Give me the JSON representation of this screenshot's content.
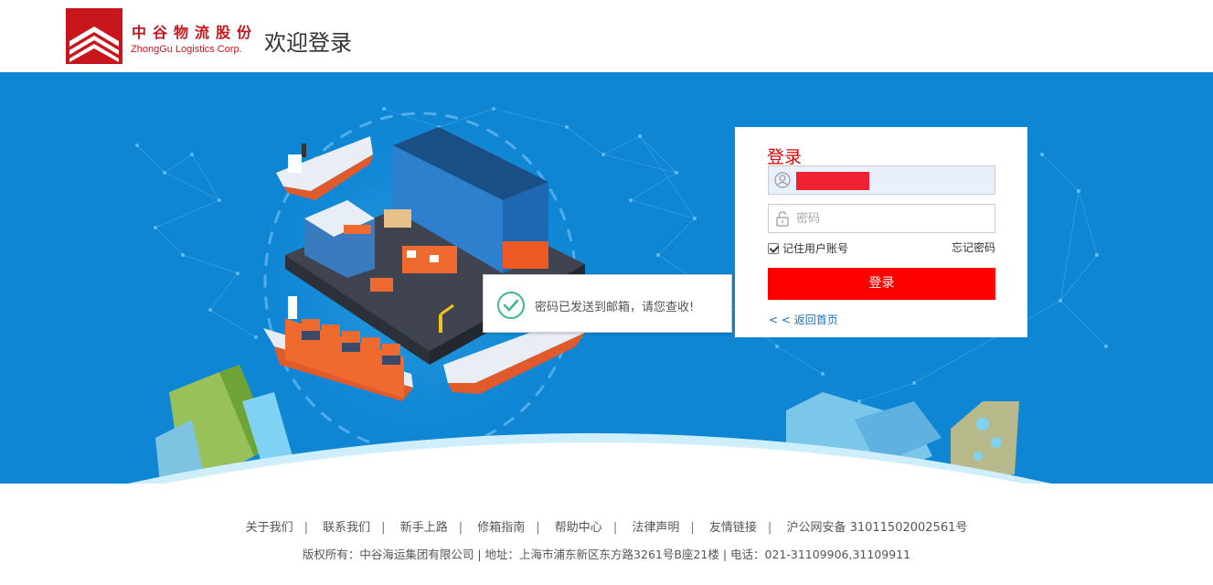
{
  "header": {
    "logo_cn": "中谷物流股份",
    "logo_en": "ZhongGu Logistics Corp.",
    "welcome": "欢迎登录"
  },
  "login": {
    "title": "登录",
    "username_value": "",
    "password_placeholder": "密码",
    "remember_label": "记住用户账号",
    "remember_checked": true,
    "forgot_label": "忘记密码",
    "submit_label": "登录",
    "back_label": "< < 返回首页"
  },
  "toast": {
    "message": "密码已发送到邮箱，请您查收!"
  },
  "footer": {
    "links": [
      "关于我们",
      "联系我们",
      "新手上路",
      "修箱指南",
      "帮助中心",
      "法律声明",
      "友情链接"
    ],
    "icp": "沪公网安备 31011502002561号",
    "copyright": "版权所有：中谷海运集团有限公司 | 地址：上海市浦东新区东方路3261号B座21楼 | 电话：021-31109906,31109911"
  },
  "colors": {
    "brand_red": "#c8161d",
    "banner_blue": "#0e86d4",
    "button_red": "#ff0000",
    "success_green": "#3fb68b"
  },
  "icons": {
    "user_field": "user-icon",
    "password_field": "lock-icon",
    "toast": "check-circle-icon"
  }
}
